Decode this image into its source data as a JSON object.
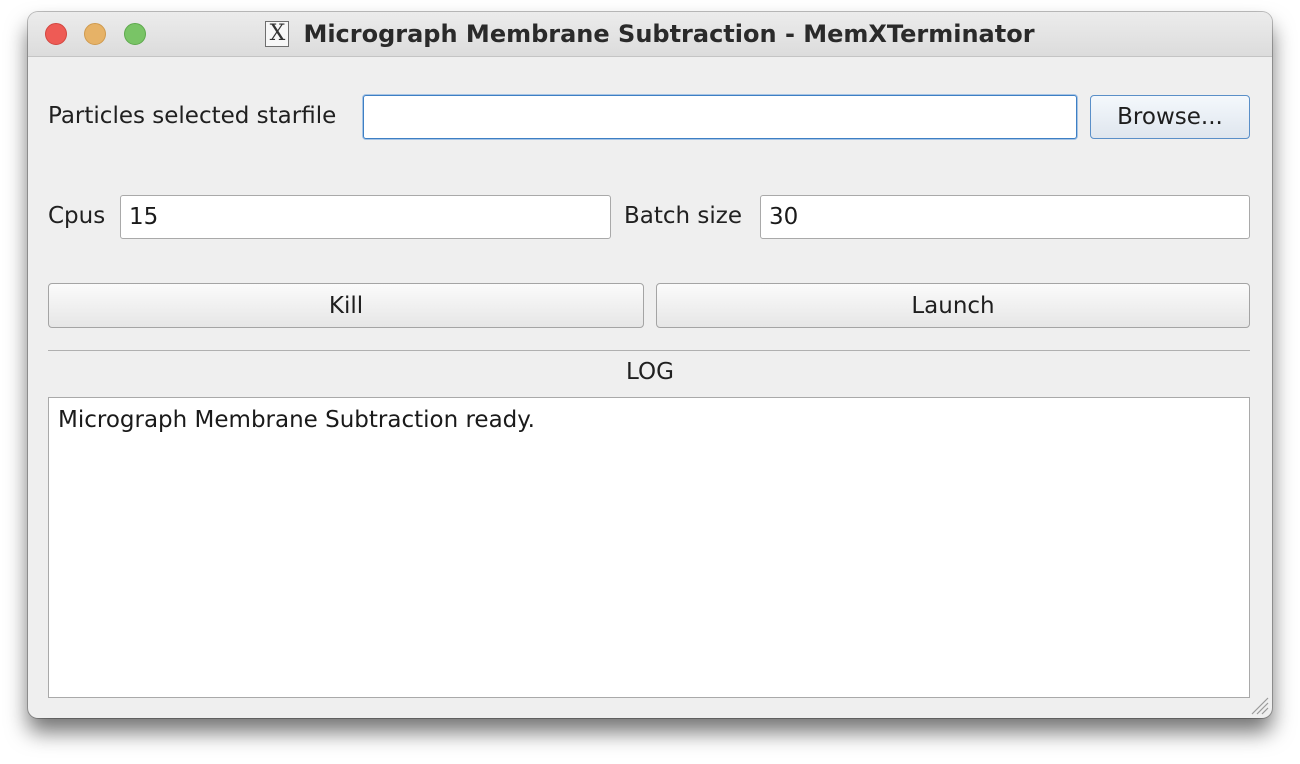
{
  "window": {
    "title": "Micrograph Membrane Subtraction - MemXTerminator",
    "app_icon_glyph": "X"
  },
  "form": {
    "starfile": {
      "label": "Particles selected starfile",
      "value": "",
      "browse_label": "Browse..."
    },
    "cpus": {
      "label": "Cpus",
      "value": "15"
    },
    "batch_size": {
      "label": "Batch size",
      "value": "30"
    }
  },
  "actions": {
    "kill_label": "Kill",
    "launch_label": "Launch"
  },
  "log": {
    "heading": "LOG",
    "text": "Micrograph Membrane Subtraction ready."
  },
  "icons": {
    "close": "close-icon",
    "minimize": "minimize-icon",
    "maximize": "maximize-icon",
    "app": "x11-app-icon",
    "resize": "resize-grip-icon"
  },
  "colors": {
    "close": "#ee5b55",
    "minimize": "#e6b267",
    "maximize": "#79c466",
    "focus_border": "#3d7fc4"
  }
}
